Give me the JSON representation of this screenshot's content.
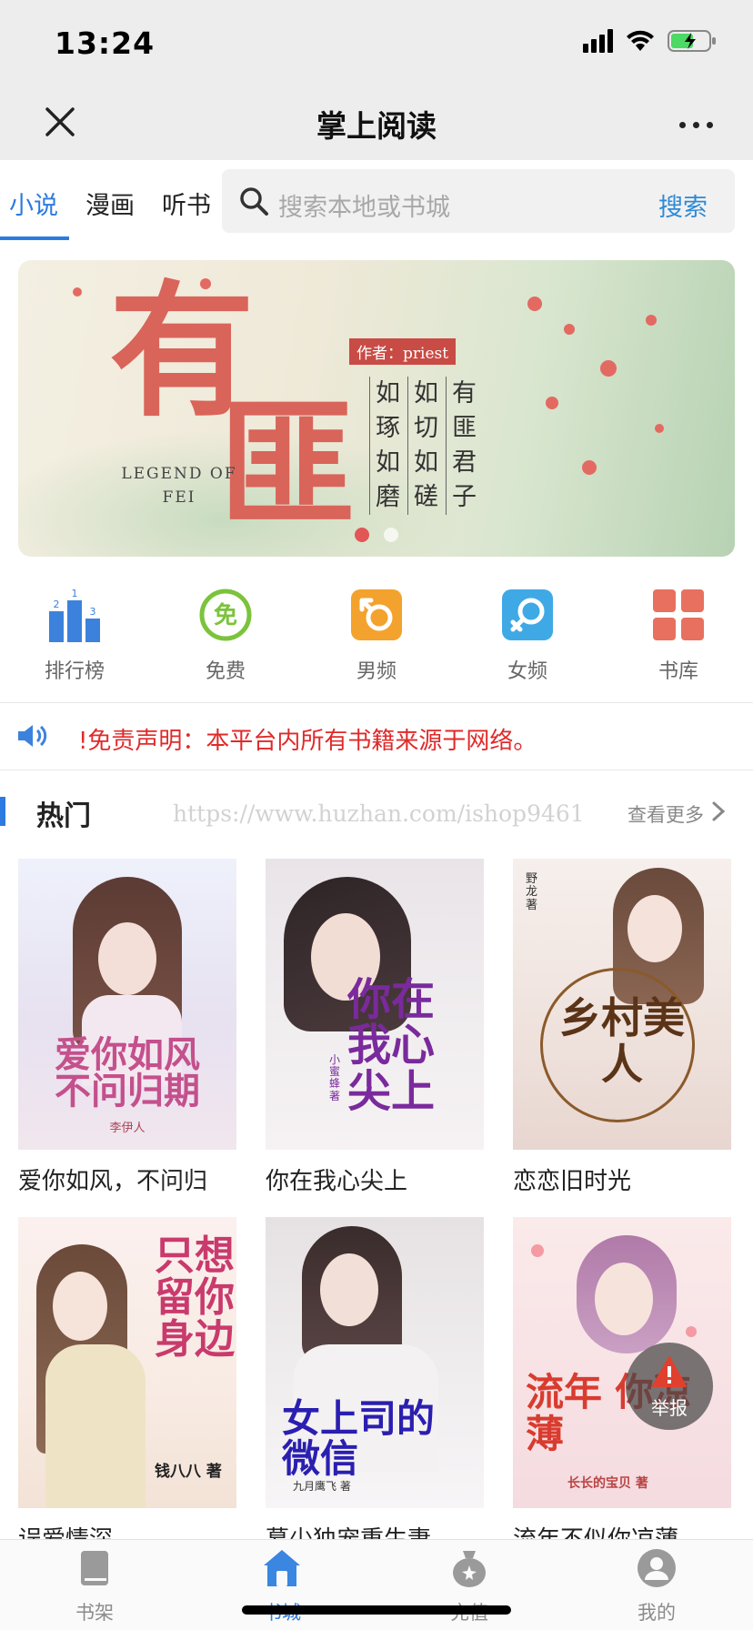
{
  "status_bar": {
    "time": "13:24"
  },
  "nav": {
    "title": "掌上阅读"
  },
  "category_tabs": [
    {
      "label": "小说",
      "active": true
    },
    {
      "label": "漫画",
      "active": false
    },
    {
      "label": "听书",
      "active": false
    }
  ],
  "search": {
    "placeholder": "搜索本地或书城",
    "button": "搜索"
  },
  "banner": {
    "title_line1": "有",
    "title_line2": "匪",
    "english_title": "LEGEND OF FEI",
    "author": "作者：priest",
    "verse_columns": [
      "有匪君子",
      "如切如磋",
      "如琢如磨"
    ],
    "slide_count": 2,
    "active_slide": 1
  },
  "quick_entries": [
    {
      "label": "排行榜",
      "icon": "ranking-icon",
      "color": "#3c82dc"
    },
    {
      "label": "免费",
      "icon": "free-icon",
      "color": "#7cc33c"
    },
    {
      "label": "男频",
      "icon": "male-icon",
      "color": "#f3a22d"
    },
    {
      "label": "女频",
      "icon": "female-icon",
      "color": "#3fa9e6"
    },
    {
      "label": "书库",
      "icon": "library-icon",
      "color": "#e8705f"
    }
  ],
  "notice": {
    "text": "!免责声明：本平台内所有书籍来源于网络。"
  },
  "hot": {
    "title": "热门",
    "watermark": "https://www.huzhan.com/ishop9461",
    "more": "查看更多"
  },
  "books": [
    {
      "title": "爱你如风，不问归",
      "cover_text": "爱你如风 不问归期",
      "cover_author": "李伊人"
    },
    {
      "title": "你在我心尖上",
      "cover_text": "你在我心尖上",
      "cover_author": "小蜜蜂 著"
    },
    {
      "title": "恋恋旧时光",
      "cover_text": "乡村美人",
      "cover_author": "野龙 著"
    },
    {
      "title": "误爱情深",
      "cover_text": "只想留你身边",
      "cover_author": "钱八八 著"
    },
    {
      "title": "慕少独宠重生妻",
      "cover_text": "女上司的微信",
      "cover_author": "九月鹰飞 著"
    },
    {
      "title": "流年不似你凉薄",
      "cover_text": "流年 你凉薄",
      "cover_author": "长长的宝贝 著"
    }
  ],
  "report": {
    "label": "举报"
  },
  "tabbar": [
    {
      "label": "书架",
      "icon": "bookshelf-icon",
      "active": false
    },
    {
      "label": "书城",
      "icon": "bookstore-icon",
      "active": true
    },
    {
      "label": "充值",
      "icon": "recharge-icon",
      "active": false
    },
    {
      "label": "我的",
      "icon": "profile-icon",
      "active": false
    }
  ]
}
